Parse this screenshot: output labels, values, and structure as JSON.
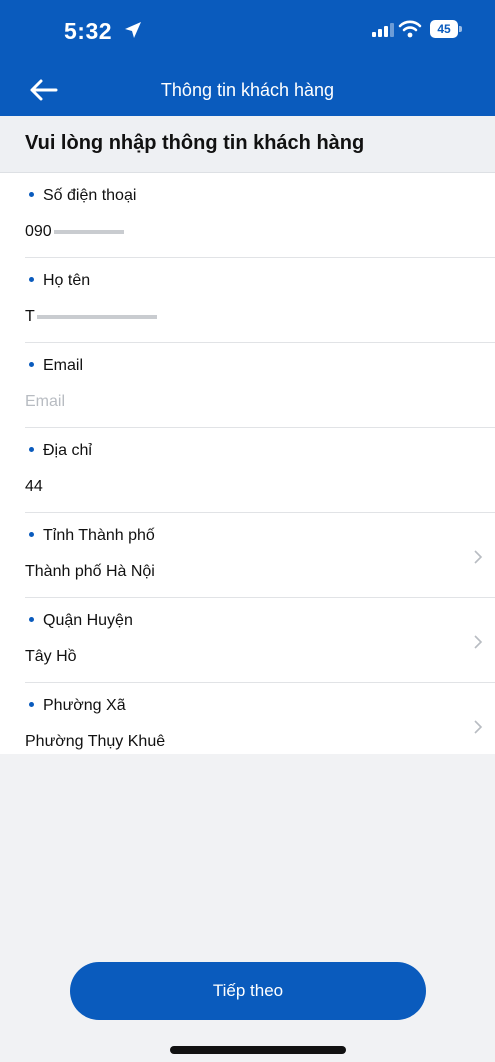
{
  "status_bar": {
    "time": "5:32",
    "battery_level": "45",
    "icons": [
      "location-arrow-icon",
      "signal-icon",
      "wifi-icon",
      "battery-icon"
    ]
  },
  "nav": {
    "title": "Thông tin khách hàng",
    "back_icon": "arrow-left-icon"
  },
  "section": {
    "title": "Vui lòng nhập thông tin khách hàng"
  },
  "fields": [
    {
      "label": "Số điện thoại",
      "value": "090",
      "masked": true
    },
    {
      "label": "Họ tên",
      "value": "T",
      "masked": true
    },
    {
      "label": "Email",
      "placeholder": "Email"
    },
    {
      "label": "Địa chỉ",
      "value": "44"
    },
    {
      "label": "Tỉnh Thành phố",
      "value": "Thành phố Hà Nội",
      "chevron": true
    },
    {
      "label": "Quận Huyện",
      "value": "Tây Hồ",
      "chevron": true
    },
    {
      "label": "Phường Xã",
      "value": "Phường Thụy Khuê",
      "chevron": true
    }
  ],
  "footer": {
    "next_label": "Tiếp theo"
  },
  "colors": {
    "primary": "#0a5bbd",
    "background_gray": "#f1f2f4",
    "placeholder": "#b8bcc2"
  }
}
